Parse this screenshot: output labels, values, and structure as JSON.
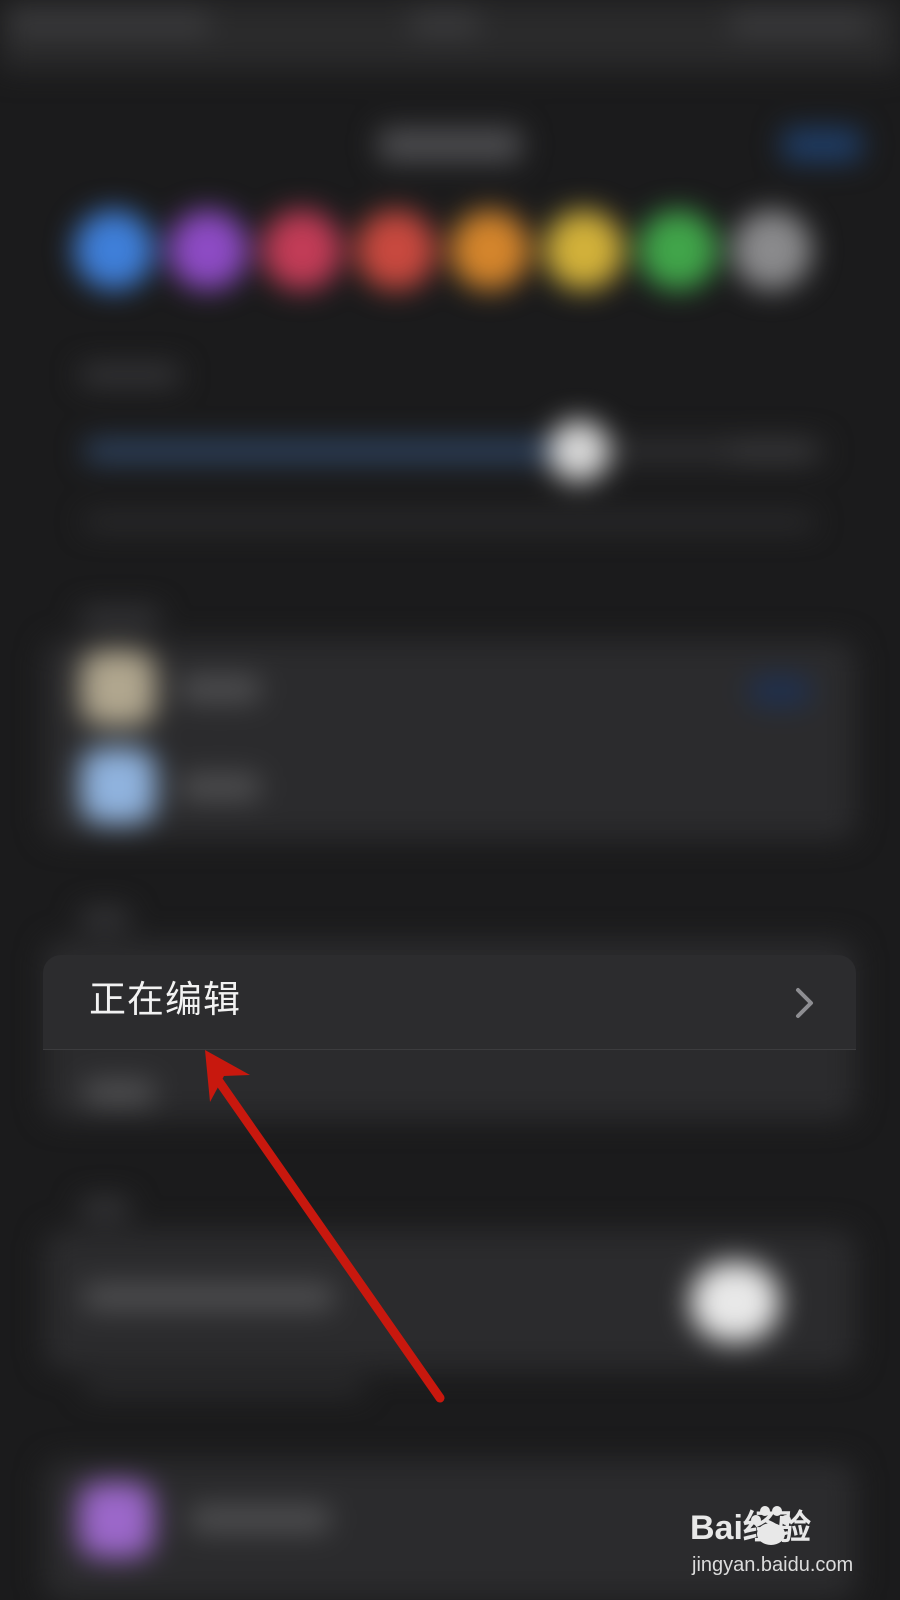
{
  "colors": {
    "background": "#1b1b1c",
    "row_background": "#2c2c2e",
    "row_text": "#f2f2f2",
    "chevron": "#8e8e92",
    "annotation_arrow": "#c8180e",
    "swatches": [
      "#3f7fd9",
      "#8d4bc4",
      "#c23c57",
      "#c8493f",
      "#d4852c",
      "#d2b13a",
      "#41a54a",
      "#8a8a8c"
    ],
    "row_icons": [
      "#b0a68e",
      "#8fb2dd",
      "#9b67c9"
    ]
  },
  "editing_row": {
    "label": "正在编辑",
    "chevron_icon": "chevron-right-icon"
  },
  "annotation": {
    "type": "arrow",
    "points_to": "editing_row"
  },
  "watermark": {
    "brand": "Bai经验",
    "url": "jingyan.baidu.com"
  }
}
